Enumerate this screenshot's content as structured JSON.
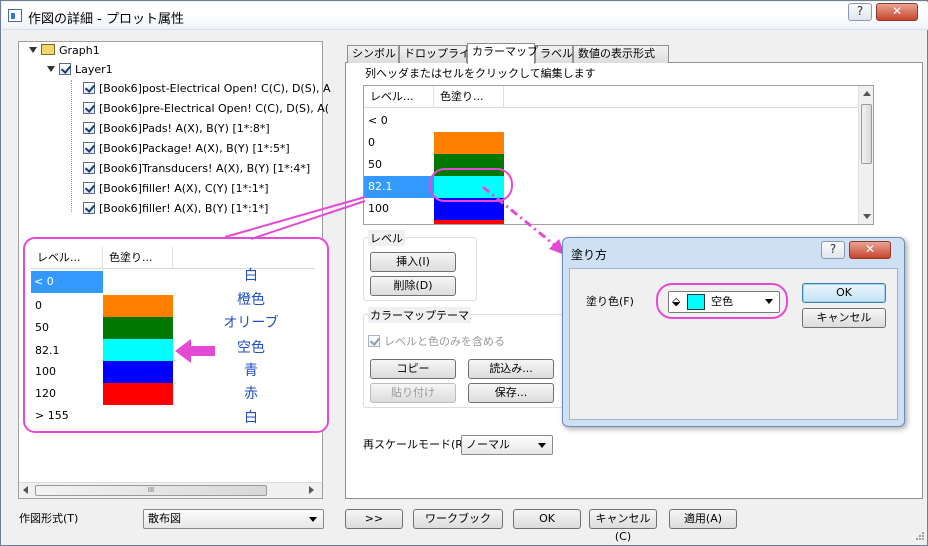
{
  "window": {
    "title": "作図の詳細 - プロット属性",
    "help_label": "?",
    "close_label": "✕"
  },
  "tree": {
    "root": "Graph1",
    "layer": "Layer1",
    "items": [
      "[Book6]post-Electrical Open! C(C), D(S), A",
      "[Book6]pre-Electrical Open! C(C), D(S), A(",
      "[Book6]Pads! A(X), B(Y) [1*:8*]",
      "[Book6]Package! A(X), B(Y) [1*:5*]",
      "[Book6]Transducers! A(X), B(Y) [1*:4*]",
      "[Book6]filler! A(X), C(Y) [1*:1*]",
      "[Book6]filler! A(X), B(Y) [1*:1*]"
    ]
  },
  "zoom_grid": {
    "headers": [
      "レベル...",
      "色塗り..."
    ],
    "levels": [
      "< 0",
      "0",
      "50",
      "82.1",
      "100",
      "120",
      "> 155"
    ],
    "fills": [
      "#ffffff",
      "#ff8000",
      "#007800",
      "#00ffff",
      "#0000ff",
      "#ff0000",
      "#ffffff"
    ],
    "color_names": [
      "白",
      "橙色",
      "オリーブ",
      "空色",
      "青",
      "赤",
      "白"
    ]
  },
  "tabs": [
    "シンボル",
    "ドロップライン",
    "カラーマップ",
    "ラベル",
    "数値の表示形式"
  ],
  "colormap": {
    "hint": "列ヘッダまたはセルをクリックして編集します",
    "headers": [
      "レベル...",
      "色塗り..."
    ],
    "levels": [
      "< 0",
      "0",
      "50",
      "82.1",
      "100"
    ],
    "fills": [
      "#ffffff",
      "#ff8000",
      "#007800",
      "#00ffff",
      "#0000ff"
    ]
  },
  "level_group": {
    "label": "レベル",
    "insert": "挿入(I)",
    "delete": "削除(D)"
  },
  "theme_group": {
    "label": "カラーマップテーマ",
    "only_levels_colors": "レベルと色のみを含める",
    "copy": "コピー",
    "load": "読込み...",
    "paste": "貼り付け",
    "save": "保存..."
  },
  "rescale": {
    "label": "再スケールモード(R)",
    "value": "ノーマル"
  },
  "fill_dialog": {
    "title": "塗り方",
    "fill_color_label": "塗り色(F)",
    "color_value": "空色",
    "swatch": "#00ffff",
    "ok": "OK",
    "cancel": "キャンセル"
  },
  "bottom": {
    "plot_type_label": "作図形式(T)",
    "plot_type_value": "散布図",
    "more": ">>",
    "workbook": "ワークブック",
    "ok": "OK",
    "cancel": "キャンセル(C)",
    "apply": "適用(A)",
    "hscroll_mark": "III"
  },
  "colors": {
    "highlight_pink": "#e54ad6",
    "selection_blue": "#3399ff",
    "dialog_border": "#6d8fb3"
  }
}
